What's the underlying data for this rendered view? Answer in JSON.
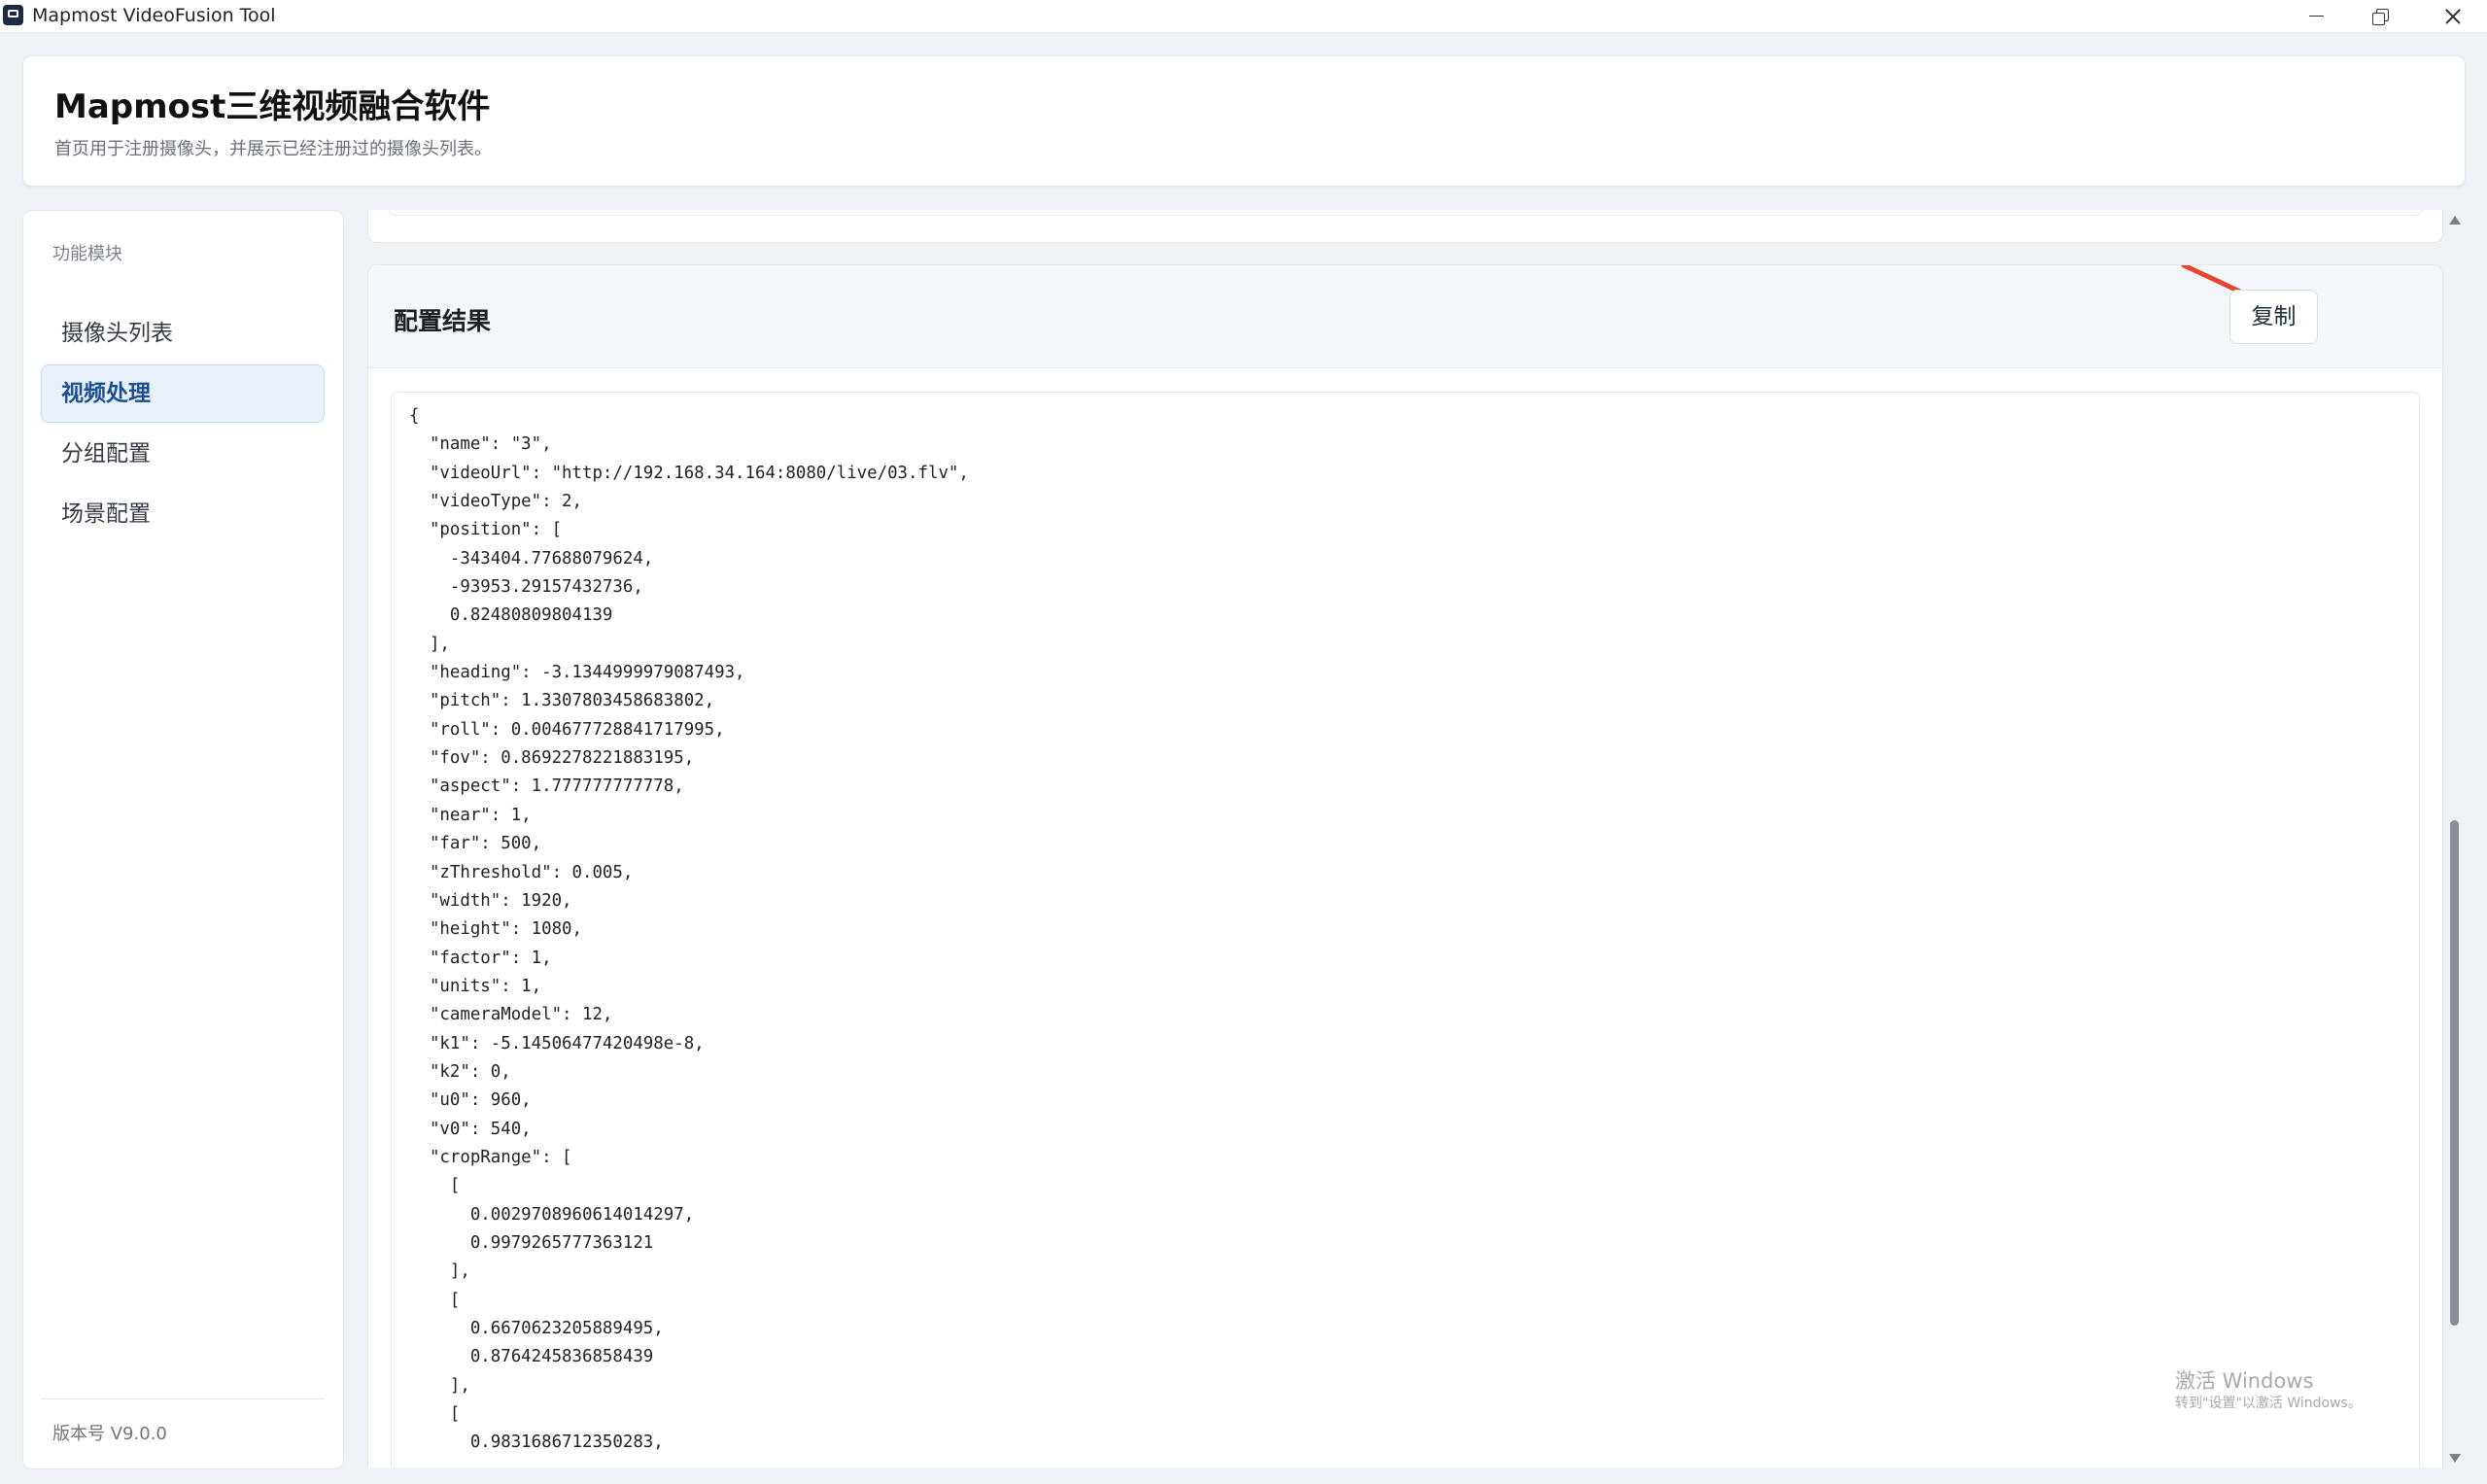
{
  "window": {
    "title": "Mapmost VideoFusion Tool"
  },
  "header": {
    "title": "Mapmost三维视频融合软件",
    "subtitle": "首页用于注册摄像头，并展示已经注册过的摄像头列表。"
  },
  "sidebar": {
    "heading": "功能模块",
    "items": [
      {
        "label": "摄像头列表",
        "active": false
      },
      {
        "label": "视频处理",
        "active": true
      },
      {
        "label": "分组配置",
        "active": false
      },
      {
        "label": "场景配置",
        "active": false
      }
    ],
    "version": "版本号 V9.0.0"
  },
  "result": {
    "title": "配置结果",
    "copy_label": "复制",
    "code_lines": [
      "{",
      "  \"name\": \"3\",",
      "  \"videoUrl\": \"http://192.168.34.164:8080/live/03.flv\",",
      "  \"videoType\": 2,",
      "  \"position\": [",
      "    -343404.77688079624,",
      "    -93953.29157432736,",
      "    0.82480809804139",
      "  ],",
      "  \"heading\": -3.1344999979087493,",
      "  \"pitch\": 1.3307803458683802,",
      "  \"roll\": 0.004677728841717995,",
      "  \"fov\": 0.8692278221883195,",
      "  \"aspect\": 1.777777777778,",
      "  \"near\": 1,",
      "  \"far\": 500,",
      "  \"zThreshold\": 0.005,",
      "  \"width\": 1920,",
      "  \"height\": 1080,",
      "  \"factor\": 1,",
      "  \"units\": 1,",
      "  \"cameraModel\": 12,",
      "  \"k1\": -5.14506477420498e-8,",
      "  \"k2\": 0,",
      "  \"u0\": 960,",
      "  \"v0\": 540,",
      "  \"cropRange\": [",
      "    [",
      "      0.0029708960614014297,",
      "      0.9979265777363121",
      "    ],",
      "    [",
      "      0.6670623205889495,",
      "      0.8764245836858439",
      "    ],",
      "    [",
      "      0.9831686712350283,"
    ]
  },
  "watermark": {
    "title": "激活 Windows",
    "subtitle": "转到\"设置\"以激活 Windows。"
  },
  "colors": {
    "accent": "#1b4f91",
    "annotation_arrow": "#e8452c"
  }
}
